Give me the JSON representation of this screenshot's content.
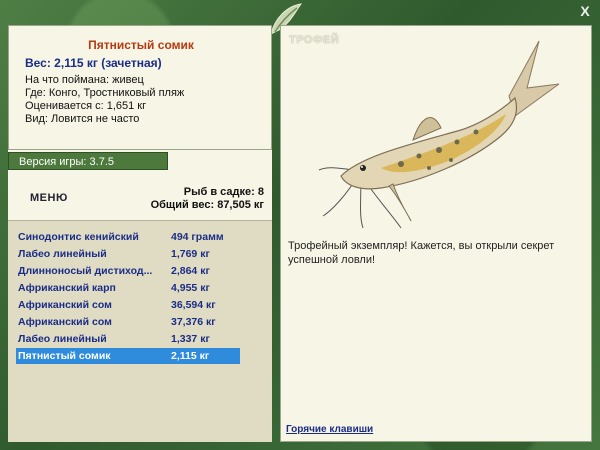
{
  "catch": {
    "title": "Пятнистый сомик",
    "weight": "Вес: 2,115 кг (зачетная)",
    "bait": "На что поймана: живец",
    "location": "Где: Конго, Тростниковый пляж",
    "value": "Оценивается с: 1,651 кг",
    "rarity": "Вид: Ловится не часто"
  },
  "version": "Версия игры: 3.7.5",
  "menu_label": "МЕНЮ",
  "stats": {
    "fish_in_keepnet": "Рыб в садке: 8",
    "total_weight": "Общий вес: 87,505 кг"
  },
  "fish_list": [
    {
      "name": "Синодонтис кенийский",
      "weight": "494 грамм"
    },
    {
      "name": "Лабео линейный",
      "weight": "1,769 кг"
    },
    {
      "name": "Длинноносый дистиход...",
      "weight": "2,864 кг"
    },
    {
      "name": "Африканский карп",
      "weight": "4,955 кг"
    },
    {
      "name": "Африканский сом",
      "weight": "36,594 кг"
    },
    {
      "name": "Африканский сом",
      "weight": "37,376 кг"
    },
    {
      "name": "Лабео линейный",
      "weight": "1,337 кг"
    },
    {
      "name": "Пятнистый сомик",
      "weight": "2,115 кг",
      "selected": true
    }
  ],
  "trophy": {
    "label": "ТРОФЕЙ",
    "text": "Трофейный экземпляр! Кажется, вы открыли секрет успешной ловли!"
  },
  "hotkeys_link": "Горячие клавиши",
  "close_label": "X",
  "colors": {
    "accent_title": "#b63a12",
    "link_blue": "#1a2d86",
    "selection": "#2f8cdc",
    "panel_bg": "#f7f5e6",
    "frame_green": "#3d6b3a"
  }
}
